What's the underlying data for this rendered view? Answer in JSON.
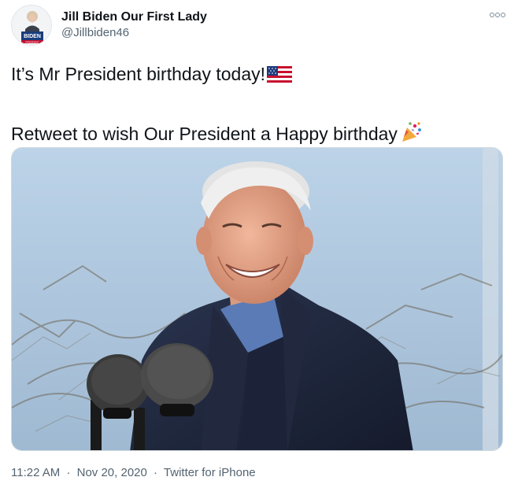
{
  "author": {
    "display_name": "Jill Biden Our First Lady",
    "handle": "@Jillbiden46",
    "avatar_badge": "BIDEN",
    "avatar_badge_sub": "PRESIDENT"
  },
  "tweet": {
    "line1": "It’s Mr President birthday today!",
    "line2": "Retweet to wish Our President a Happy birthday",
    "emoji1": "us-flag-emoji",
    "emoji2": "party-popper-emoji"
  },
  "meta": {
    "time": "11:22 AM",
    "date": "Nov 20, 2020",
    "source": "Twitter for iPhone",
    "separator": "·"
  },
  "colors": {
    "text": "#0f1419",
    "secondary": "#536471",
    "border": "#cfd9de",
    "sky": "#a9c4dc"
  }
}
